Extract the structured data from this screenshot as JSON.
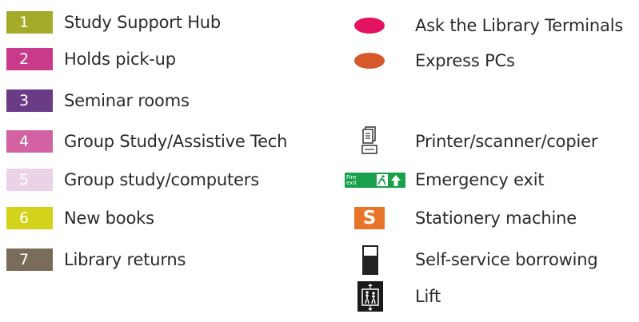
{
  "colors": {
    "swatch_1": "#a3ac2a",
    "swatch_2": "#c93a8a",
    "swatch_3": "#6a3b86",
    "swatch_4": "#d262a2",
    "swatch_5": "#ead3e6",
    "swatch_6": "#d2d31a",
    "swatch_7": "#7a6c5b",
    "ask_terminals": "#e3135f",
    "express_pcs": "#d6582b",
    "fire_exit": "#18a04a",
    "stationery": "#e8742a"
  },
  "left_items": [
    {
      "number": "1",
      "label": "Study Support Hub"
    },
    {
      "number": "2",
      "label": "Holds pick-up"
    },
    {
      "number": "3",
      "label": "Seminar rooms"
    },
    {
      "number": "4",
      "label": "Group Study/Assistive Tech"
    },
    {
      "number": "5",
      "label": "Group study/computers"
    },
    {
      "number": "6",
      "label": "New books"
    },
    {
      "number": "7",
      "label": "Library returns"
    }
  ],
  "right_items": [
    {
      "icon": "pink-oval-icon",
      "label": "Ask the Library Terminals"
    },
    {
      "icon": "orange-oval-icon",
      "label": "Express PCs"
    },
    {
      "icon": "printer-icon",
      "label": "Printer/scanner/copier"
    },
    {
      "icon": "emergency-exit-sign-icon",
      "label": "Emergency exit",
      "sign_text": "Fire exit"
    },
    {
      "icon": "stationery-s-icon",
      "label": "Stationery machine",
      "icon_text": "S"
    },
    {
      "icon": "self-service-kiosk-icon",
      "label": "Self-service borrowing"
    },
    {
      "icon": "lift-icon",
      "label": "Lift"
    }
  ]
}
